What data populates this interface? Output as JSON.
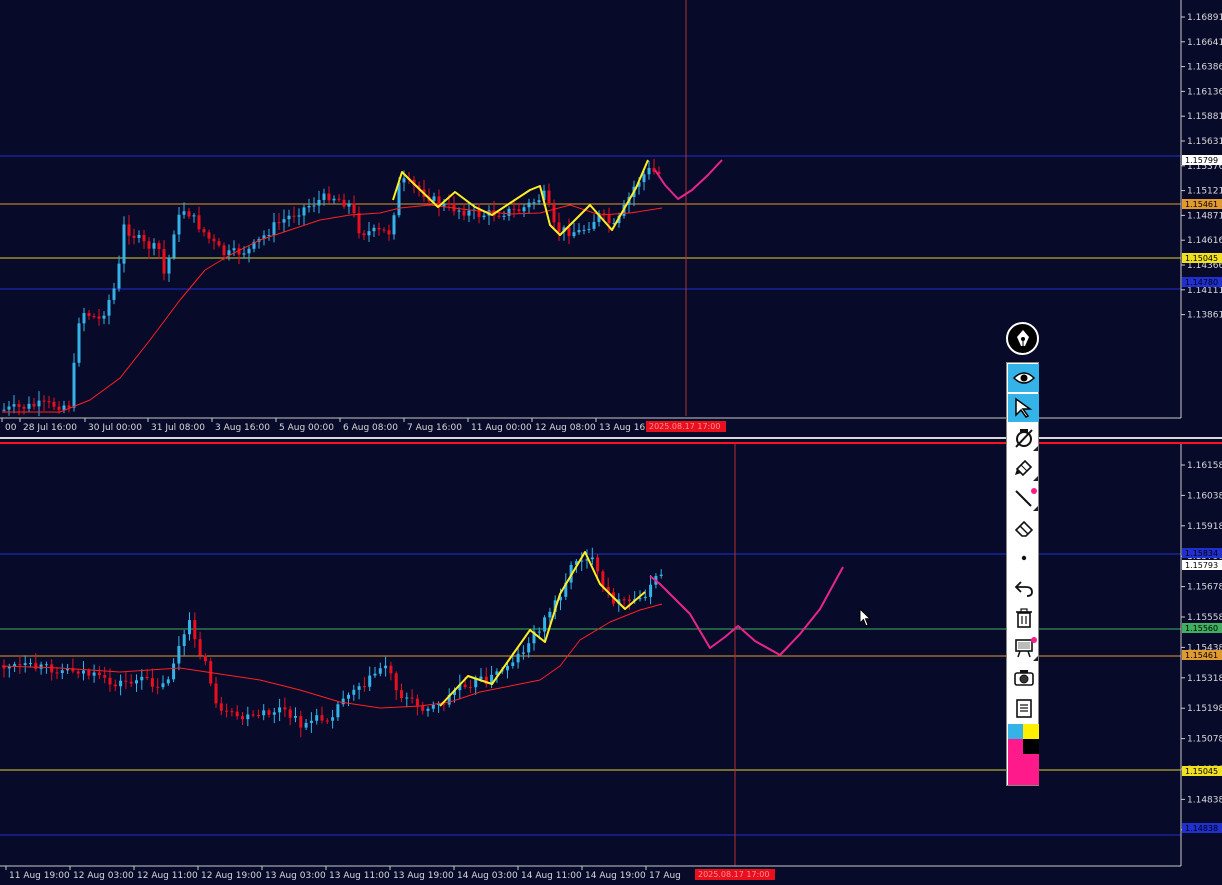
{
  "colors": {
    "background": "#080a2a",
    "bull": "#33b3e8",
    "bear": "#e8101e",
    "ma": "#ff2020",
    "zigzag": "#ffee22",
    "drawing": "#e8248c",
    "level_orange": "#e09a30",
    "level_yellow": "#e0d030",
    "level_blue": "#2030d0",
    "level_green": "#40b060",
    "crosshair": "#b03030"
  },
  "top_chart": {
    "price_labels": [
      "1.16891",
      "1.16641",
      "1.16386",
      "1.16136",
      "1.15881",
      "1.15631",
      "1.15376",
      "1.15121",
      "1.14871",
      "1.14616",
      "1.14366",
      "1.14111",
      "1.13861"
    ],
    "price_tags": [
      {
        "label": "1.15799",
        "bg": "#ffffff",
        "fg": "#000000"
      },
      {
        "label": "1.15461",
        "bg": "#e09a30",
        "fg": "#000000"
      },
      {
        "label": "1.15045",
        "bg": "#f0e020",
        "fg": "#000000"
      },
      {
        "label": "1.14780",
        "bg": "#2030d0",
        "fg": "#000000"
      }
    ],
    "time_labels": [
      "00",
      "28 Jul 16:00",
      "30 Jul 00:00",
      "31 Jul 08:00",
      "3 Aug 16:00",
      "5 Aug 00:00",
      "6 Aug 08:00",
      "7 Aug 16:00",
      "11 Aug 00:00",
      "12 Aug 08:00",
      "13 Aug 16:0"
    ],
    "crosshair_time": "2025.08.17 17:00"
  },
  "bottom_chart": {
    "price_labels": [
      "1.16158",
      "1.16038",
      "1.15918",
      "1.15798",
      "1.15678",
      "1.15558",
      "1.15438",
      "1.15318",
      "1.15198",
      "1.15078",
      "1.14958",
      "1.14838",
      "1.14718"
    ],
    "price_tags": [
      {
        "label": "1.15834",
        "bg": "#2030d0",
        "fg": "#000000"
      },
      {
        "label": "1.15793",
        "bg": "#ffffff",
        "fg": "#000000"
      },
      {
        "label": "1.15560",
        "bg": "#40b060",
        "fg": "#000000"
      },
      {
        "label": "1.15461",
        "bg": "#e09a30",
        "fg": "#000000"
      },
      {
        "label": "1.15045",
        "bg": "#f0e020",
        "fg": "#000000"
      },
      {
        "label": "1.14838",
        "bg": "#2030d0",
        "fg": "#000000"
      }
    ],
    "time_labels": [
      "11 Aug 19:00",
      "12 Aug 03:00",
      "12 Aug 11:00",
      "12 Aug 19:00",
      "13 Aug 03:00",
      "13 Aug 11:00",
      "13 Aug 19:00",
      "14 Aug 03:00",
      "14 Aug 11:00",
      "14 Aug 19:00",
      "17 Aug"
    ],
    "crosshair_time": "2025.08.17 17:00"
  },
  "toolbar": {
    "tools": [
      {
        "icon": "eye-icon",
        "active": true
      },
      {
        "icon": "cursor-arrow-icon",
        "active": true
      },
      {
        "icon": "magnet-off-icon",
        "active": false
      },
      {
        "icon": "marker-icon",
        "active": false
      },
      {
        "icon": "line-icon",
        "active": false
      },
      {
        "icon": "eraser-icon",
        "active": false
      },
      {
        "icon": "dot-size-icon",
        "active": false
      },
      {
        "icon": "undo-icon",
        "active": false
      },
      {
        "icon": "trash-icon",
        "active": false
      },
      {
        "icon": "projector-icon",
        "active": false
      },
      {
        "icon": "camera-icon",
        "active": false
      },
      {
        "icon": "notes-icon",
        "active": false
      }
    ],
    "palette": [
      "#33b3e8",
      "#ffee00",
      "#ff1a8c",
      "#000000"
    ]
  }
}
